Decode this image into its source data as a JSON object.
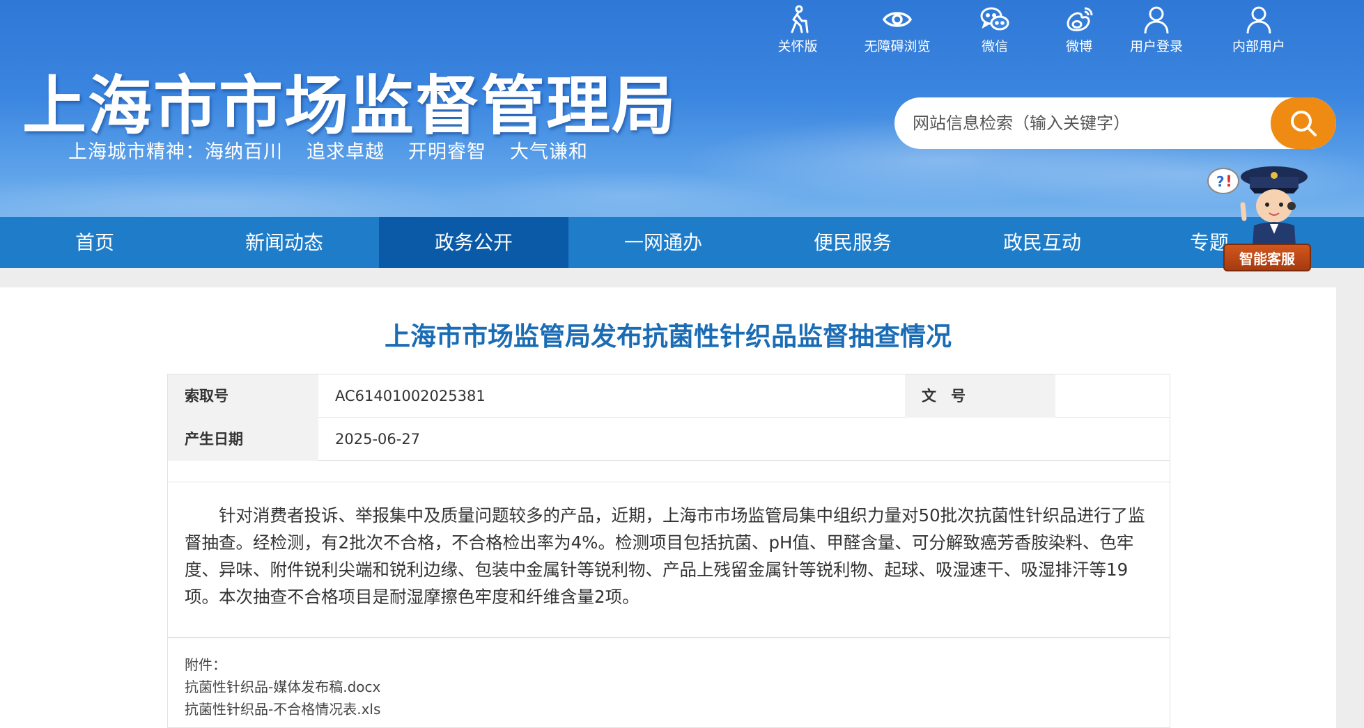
{
  "header": {
    "site_title": "上海市市场监督管理局",
    "slogan": [
      "上海城市精神：海纳百川",
      "追求卓越",
      "开明睿智",
      "大气谦和"
    ],
    "tools": [
      {
        "label": "关怀版",
        "icon": "elder-care-icon"
      },
      {
        "label": "无障碍浏览",
        "icon": "eye-icon"
      },
      {
        "label": "微信",
        "icon": "wechat-icon"
      },
      {
        "label": "微博",
        "icon": "weibo-icon"
      },
      {
        "label": "用户登录",
        "icon": "user-icon"
      },
      {
        "label": "内部用户",
        "icon": "user-icon"
      }
    ],
    "search": {
      "placeholder": "网站信息检索（输入关键字）",
      "icon": "search-icon"
    },
    "colors": {
      "header_blue": "#2f78d6",
      "nav_blue": "#1e7cc9",
      "nav_active": "#0a5aa8",
      "search_orange": "#ef8a12",
      "title_blue": "#1a6cb5"
    }
  },
  "nav": {
    "items": [
      "首页",
      "新闻动态",
      "政务公开",
      "一网通办",
      "便民服务",
      "政民互动",
      "专题"
    ],
    "active": "政务公开"
  },
  "agent": {
    "label": "智能客服"
  },
  "article": {
    "title": "上海市市场监管局发布抗菌性针织品监督抽查情况",
    "meta": {
      "index_no_label": "索取号",
      "index_no": "AC61401002025381",
      "doc_no_label": "文　号",
      "doc_no": "",
      "date_label": "产生日期",
      "date": "2025-06-27"
    },
    "body": "针对消费者投诉、举报集中及质量问题较多的产品，近期，上海市市场监管局集中组织力量对50批次抗菌性针织品进行了监督抽查。经检测，有2批次不合格，不合格检出率为4%。检测项目包括抗菌、pH值、甲醛含量、可分解致癌芳香胺染料、色牢度、异味、附件锐利尖端和锐利边缘、包装中金属针等锐利物、产品上残留金属针等锐利物、起球、吸湿速干、吸湿排汗等19项。本次抽查不合格项目是耐湿摩擦色牢度和纤维含量2项。",
    "attachments_label": "附件：",
    "attachments": [
      "抗菌性针织品-媒体发布稿.docx",
      "抗菌性针织品-不合格情况表.xls"
    ]
  }
}
